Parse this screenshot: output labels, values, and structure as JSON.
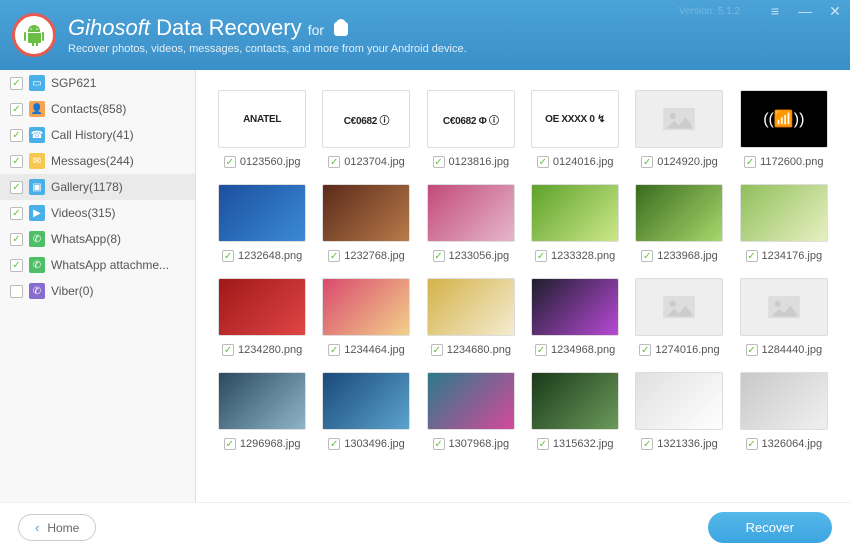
{
  "header": {
    "brand": "Gihosoft",
    "product": "Data Recovery",
    "for": "for",
    "subtitle": "Recover photos, videos, messages, contacts, and more from your Android device.",
    "version": "Version: 5.1.2"
  },
  "sidebar": {
    "items": [
      {
        "label": "SGP621",
        "checked": true,
        "iconColor": "#4ab0e8",
        "iconGlyph": "▭",
        "iconName": "device-icon"
      },
      {
        "label": "Contacts(858)",
        "checked": true,
        "iconColor": "#f7a34f",
        "iconGlyph": "👤",
        "iconName": "contacts-icon"
      },
      {
        "label": "Call History(41)",
        "checked": true,
        "iconColor": "#4ab0e8",
        "iconGlyph": "☎",
        "iconName": "call-history-icon"
      },
      {
        "label": "Messages(244)",
        "checked": true,
        "iconColor": "#f7c84f",
        "iconGlyph": "✉",
        "iconName": "messages-icon"
      },
      {
        "label": "Gallery(1178)",
        "checked": true,
        "iconColor": "#4ab0e8",
        "iconGlyph": "▣",
        "iconName": "gallery-icon",
        "selected": true
      },
      {
        "label": "Videos(315)",
        "checked": true,
        "iconColor": "#4ab0e8",
        "iconGlyph": "▶",
        "iconName": "videos-icon"
      },
      {
        "label": "WhatsApp(8)",
        "checked": true,
        "iconColor": "#4fbf67",
        "iconGlyph": "✆",
        "iconName": "whatsapp-icon"
      },
      {
        "label": "WhatsApp attachme...",
        "checked": true,
        "iconColor": "#4fbf67",
        "iconGlyph": "✆",
        "iconName": "whatsapp-attach-icon"
      },
      {
        "label": "Viber(0)",
        "checked": false,
        "iconColor": "#8a6bcf",
        "iconGlyph": "✆",
        "iconName": "viber-icon"
      }
    ]
  },
  "gallery": {
    "items": [
      {
        "filename": "0123560.jpg",
        "checked": true,
        "kind": "labeltext",
        "text": "ANATEL"
      },
      {
        "filename": "0123704.jpg",
        "checked": true,
        "kind": "labeltext",
        "text": "C€0682 ⓘ"
      },
      {
        "filename": "0123816.jpg",
        "checked": true,
        "kind": "labeltext",
        "text": "C€0682 Φ ⓘ"
      },
      {
        "filename": "0124016.jpg",
        "checked": true,
        "kind": "labeltext",
        "text": "OE XXXX 0 ↯"
      },
      {
        "filename": "0124920.jpg",
        "checked": true,
        "kind": "placeholder"
      },
      {
        "filename": "1172600.png",
        "checked": true,
        "kind": "dark",
        "text": "((📶))"
      },
      {
        "filename": "1232648.png",
        "checked": true,
        "kind": "img",
        "grad": [
          "#1b4f9e",
          "#3b8ad6"
        ]
      },
      {
        "filename": "1232768.jpg",
        "checked": true,
        "kind": "img",
        "grad": [
          "#5b2a1a",
          "#b87b4a"
        ]
      },
      {
        "filename": "1233056.jpg",
        "checked": true,
        "kind": "img",
        "grad": [
          "#c24a7a",
          "#e6b7cc"
        ]
      },
      {
        "filename": "1233328.png",
        "checked": true,
        "kind": "img",
        "grad": [
          "#5da22a",
          "#cde88a"
        ]
      },
      {
        "filename": "1233968.jpg",
        "checked": true,
        "kind": "img",
        "grad": [
          "#3a6b1e",
          "#a7d86c"
        ]
      },
      {
        "filename": "1234176.jpg",
        "checked": true,
        "kind": "img",
        "grad": [
          "#8fbf5a",
          "#e8f0c2"
        ]
      },
      {
        "filename": "1234280.png",
        "checked": true,
        "kind": "img",
        "grad": [
          "#a01818",
          "#e04545"
        ]
      },
      {
        "filename": "1234464.jpg",
        "checked": true,
        "kind": "img",
        "grad": [
          "#d94a6e",
          "#f2d08a"
        ]
      },
      {
        "filename": "1234680.png",
        "checked": true,
        "kind": "img",
        "grad": [
          "#d4b24a",
          "#f4ecd0"
        ]
      },
      {
        "filename": "1234968.png",
        "checked": true,
        "kind": "img",
        "grad": [
          "#1e1e2e",
          "#b84ad6"
        ]
      },
      {
        "filename": "1274016.png",
        "checked": true,
        "kind": "placeholder"
      },
      {
        "filename": "1284440.jpg",
        "checked": true,
        "kind": "placeholder"
      },
      {
        "filename": "1296968.jpg",
        "checked": true,
        "kind": "img",
        "grad": [
          "#2a4a5e",
          "#8fb5c8"
        ]
      },
      {
        "filename": "1303496.jpg",
        "checked": true,
        "kind": "img",
        "grad": [
          "#1a4a7a",
          "#5ba3cc"
        ]
      },
      {
        "filename": "1307968.jpg",
        "checked": true,
        "kind": "img",
        "grad": [
          "#2a7a8a",
          "#d44a9a"
        ]
      },
      {
        "filename": "1315632.jpg",
        "checked": true,
        "kind": "img",
        "grad": [
          "#1a3a1a",
          "#6b9a5a"
        ]
      },
      {
        "filename": "1321336.jpg",
        "checked": true,
        "kind": "img",
        "grad": [
          "#e0e0e0",
          "#ffffff"
        ]
      },
      {
        "filename": "1326064.jpg",
        "checked": true,
        "kind": "img",
        "grad": [
          "#c8c8c8",
          "#f0f0f0"
        ]
      }
    ]
  },
  "footer": {
    "home": "Home",
    "recover": "Recover"
  }
}
